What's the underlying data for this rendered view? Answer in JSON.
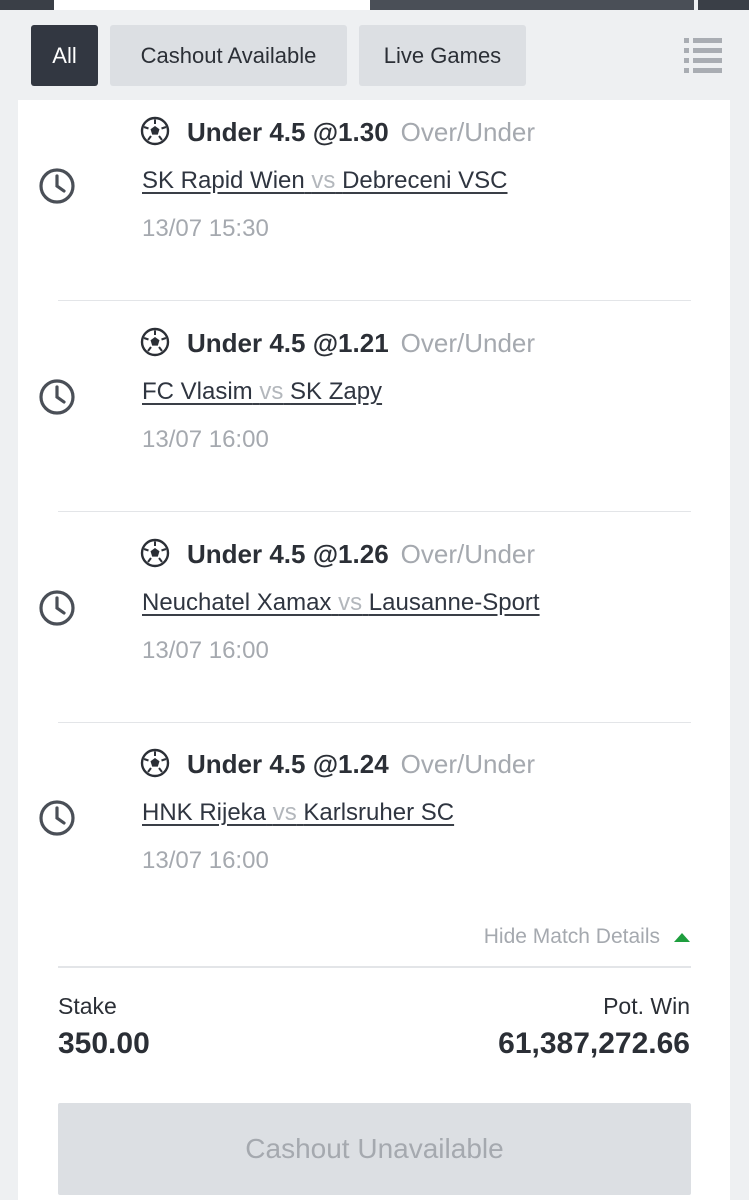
{
  "filters": {
    "all": "All",
    "cashout_available": "Cashout Available",
    "live_games": "Live Games"
  },
  "selections": [
    {
      "market": "Under 4.5 @1.30",
      "market_type": "Over/Under",
      "home": "SK Rapid Wien",
      "vs": "vs",
      "away": "Debreceni VSC",
      "datetime": "13/07 15:30"
    },
    {
      "market": "Under 4.5 @1.21",
      "market_type": "Over/Under",
      "home": "FC Vlasim",
      "vs": "vs",
      "away": "SK Zapy",
      "datetime": "13/07 16:00"
    },
    {
      "market": "Under 4.5 @1.26",
      "market_type": "Over/Under",
      "home": "Neuchatel Xamax",
      "vs": "vs",
      "away": "Lausanne-Sport",
      "datetime": "13/07 16:00"
    },
    {
      "market": "Under 4.5 @1.24",
      "market_type": "Over/Under",
      "home": "HNK Rijeka",
      "vs": "vs",
      "away": "Karlsruher SC",
      "datetime": "13/07 16:00"
    }
  ],
  "details_toggle": "Hide Match Details",
  "summary": {
    "stake_label": "Stake",
    "stake_value": "350.00",
    "pot_win_label": "Pot. Win",
    "pot_win_value": "61,387,272.66"
  },
  "cashout_button": "Cashout Unavailable",
  "icons": {
    "menu": "list-menu-icon",
    "clock": "clock-icon",
    "sport": "soccer-ball-icon",
    "toggle": "triangle-up-icon"
  },
  "colors": {
    "active_filter_bg": "#323741",
    "inactive_filter_bg": "#dcdfe3",
    "muted_text": "#a5a9af",
    "toggle_arrow": "#1e9e3e"
  }
}
